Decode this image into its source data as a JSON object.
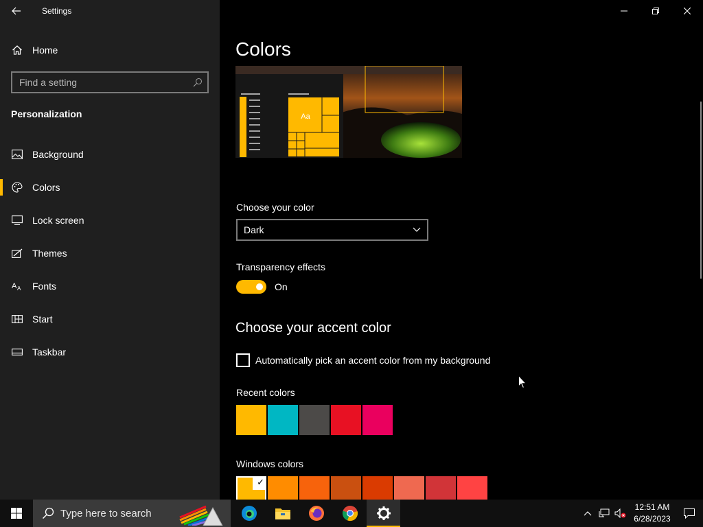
{
  "window": {
    "title": "Settings",
    "controls": [
      "minimize-icon",
      "restore-icon",
      "close-icon"
    ]
  },
  "sidebar": {
    "home_label": "Home",
    "search_placeholder": "Find a setting",
    "section_title": "Personalization",
    "items": [
      {
        "label": "Background",
        "icon": "picture-icon"
      },
      {
        "label": "Colors",
        "icon": "palette-icon",
        "active": true
      },
      {
        "label": "Lock screen",
        "icon": "lock-screen-icon"
      },
      {
        "label": "Themes",
        "icon": "themes-icon"
      },
      {
        "label": "Fonts",
        "icon": "fonts-icon"
      },
      {
        "label": "Start",
        "icon": "start-icon"
      },
      {
        "label": "Taskbar",
        "icon": "taskbar-icon"
      }
    ]
  },
  "main": {
    "title": "Colors",
    "preview": {
      "tile_text": "Aa"
    },
    "choose_color_label": "Choose your color",
    "choose_color_value": "Dark",
    "transparency_label": "Transparency effects",
    "transparency_state": "On",
    "accent_title": "Choose your accent color",
    "auto_pick_label": "Automatically pick an accent color from my background",
    "auto_pick_checked": false,
    "recent_label": "Recent colors",
    "recent_colors": [
      "#ffb900",
      "#00b7c3",
      "#4c4a48",
      "#e81123",
      "#ea005e"
    ],
    "windows_label": "Windows colors",
    "windows_colors": [
      "#ffb900",
      "#ff8c00",
      "#f7630c",
      "#ca5010",
      "#da3b01",
      "#ef6950",
      "#d13438",
      "#ff4343"
    ],
    "selected_color": "#ffb900"
  },
  "taskbar": {
    "search_placeholder": "Type here to search",
    "apps": [
      "edge-icon",
      "file-explorer-icon",
      "firefox-icon",
      "chrome-icon",
      "settings-icon"
    ],
    "time": "12:51 AM",
    "date": "6/28/2023"
  },
  "colors": {
    "accent": "#ffb900",
    "sidebar_bg": "#1f1f1f",
    "main_bg": "#000000"
  }
}
